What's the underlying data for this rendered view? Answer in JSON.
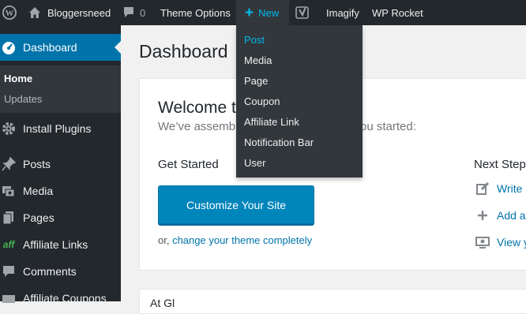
{
  "admin_bar": {
    "site_name": "Bloggersneed",
    "comments_count": "0",
    "theme_options": "Theme Options",
    "new_label": "New",
    "imagify": "Imagify",
    "wp_rocket": "WP Rocket",
    "icons": [
      "wordpress-logo-icon",
      "home-icon",
      "comment-bubble-icon",
      "plus-icon",
      "yoast-icon"
    ]
  },
  "new_menu": {
    "items": [
      "Post",
      "Media",
      "Page",
      "Coupon",
      "Affiliate Link",
      "Notification Bar",
      "User"
    ],
    "highlighted": "Post"
  },
  "sidebar": {
    "dashboard": "Dashboard",
    "submenu": [
      "Home",
      "Updates"
    ],
    "items": [
      "Install Plugins",
      "Posts",
      "Media",
      "Pages",
      "Affiliate Links",
      "Comments",
      "Affiliate Coupons"
    ]
  },
  "main": {
    "page_title": "Dashboard",
    "welcome": {
      "title": "Welcome t",
      "about": "We’ve assemb",
      "about_tail": "ou started:",
      "get_started": "Get Started",
      "customize_button": "Customize Your Site",
      "or_text": "or, ",
      "change_theme_link": "change your theme completely",
      "next_steps": "Next Step",
      "next_step_items": [
        "Write",
        "Add a",
        "View y"
      ]
    },
    "second_panel_title": "At Gl"
  },
  "colors": {
    "admin_bg": "#23282d",
    "accent": "#0073aa",
    "button": "#0085ba",
    "highlight": "#00b9eb"
  }
}
